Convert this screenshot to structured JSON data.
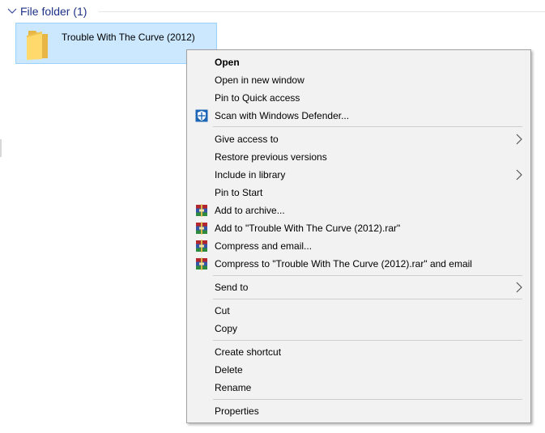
{
  "group": {
    "title": "File folder (1)"
  },
  "folder": {
    "name": "Trouble With The Curve (2012)"
  },
  "menu": {
    "open": "Open",
    "open_new_window": "Open in new window",
    "pin_quick_access": "Pin to Quick access",
    "scan_defender": "Scan with Windows Defender...",
    "give_access": "Give access to",
    "restore_previous": "Restore previous versions",
    "include_library": "Include in library",
    "pin_start": "Pin to Start",
    "add_archive": "Add to archive...",
    "add_rar": "Add to \"Trouble With The Curve (2012).rar\"",
    "compress_email": "Compress and email...",
    "compress_rar_email": "Compress to \"Trouble With The Curve (2012).rar\" and email",
    "send_to": "Send to",
    "cut": "Cut",
    "copy": "Copy",
    "create_shortcut": "Create shortcut",
    "delete": "Delete",
    "rename": "Rename",
    "properties": "Properties"
  },
  "icons": {
    "group_chevron": "chevron-down-icon",
    "folder": "folder-icon",
    "defender": "windows-defender-shield-icon",
    "winrar": "winrar-books-icon",
    "submenu": "chevron-right-icon"
  },
  "colors": {
    "selection_bg": "#cce8ff",
    "selection_border": "#99d1ff",
    "group_title": "#1e3287",
    "menu_bg": "#f2f2f2",
    "defender_blue": "#1c66b5"
  }
}
